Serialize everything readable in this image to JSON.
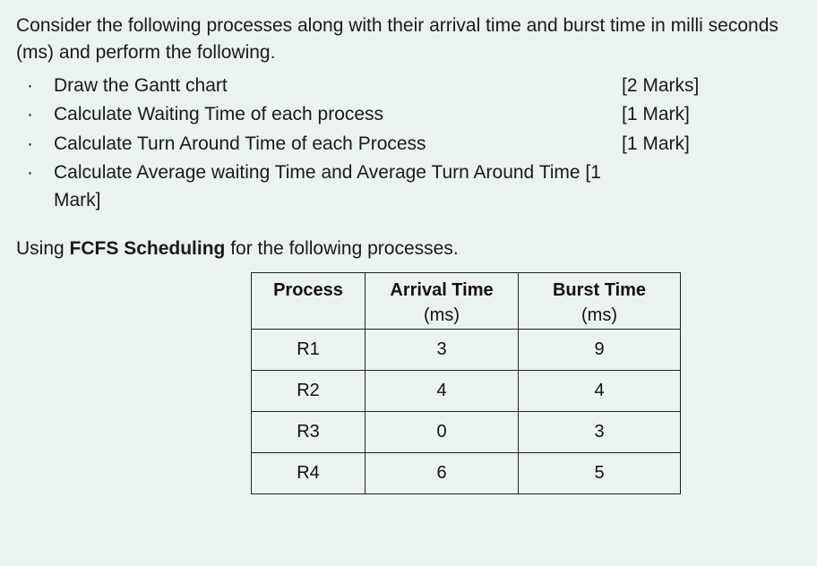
{
  "intro": "Consider the following processes along with their arrival time and burst time in milli seconds (ms) and perform the following.",
  "bullets": [
    {
      "text": "Draw the Gantt chart",
      "marks": "[2 Marks]"
    },
    {
      "text": "Calculate Waiting Time of each process",
      "marks": "[1 Mark]"
    },
    {
      "text": "Calculate Turn Around Time of each Process",
      "marks": "[1 Mark]"
    },
    {
      "text": "Calculate Average waiting Time and Average Turn Around Time [1 Mark]",
      "marks": ""
    }
  ],
  "instruction_prefix": "Using ",
  "instruction_bold": "FCFS Scheduling",
  "instruction_suffix": " for the following processes.",
  "table": {
    "headers": {
      "process": "Process",
      "arrival": "Arrival Time",
      "arrival_unit": "(ms)",
      "burst": "Burst Time",
      "burst_unit": "(ms)"
    },
    "rows": [
      {
        "process": "R1",
        "arrival": "3",
        "burst": "9"
      },
      {
        "process": "R2",
        "arrival": "4",
        "burst": "4"
      },
      {
        "process": "R3",
        "arrival": "0",
        "burst": "3"
      },
      {
        "process": "R4",
        "arrival": "6",
        "burst": "5"
      }
    ]
  }
}
